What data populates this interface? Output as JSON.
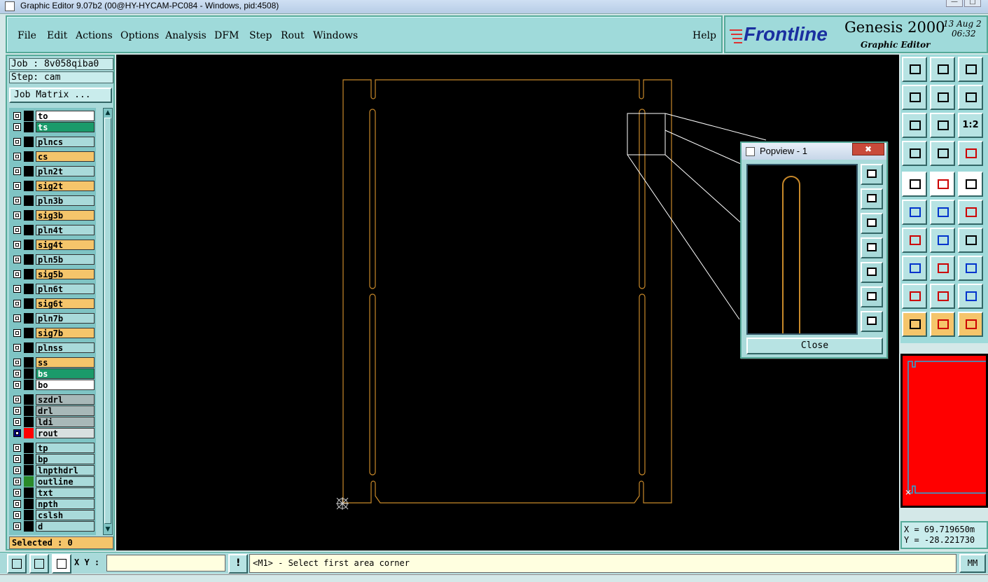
{
  "window": {
    "title": "Graphic Editor 9.07b2 (00@HY-HYCAM-PC084 - Windows, pid:4508)"
  },
  "menu": {
    "items": [
      "File",
      "Edit",
      "Actions",
      "Options",
      "Analysis",
      "DFM",
      "Step",
      "Rout",
      "Windows"
    ],
    "help": "Help"
  },
  "brand": {
    "logo": "Frontline",
    "product": "Genesis 2000",
    "subtitle": "Graphic Editor",
    "date": "13 Aug 2",
    "time": "06:32"
  },
  "job": {
    "job_line": "Job : 8v058qiba0",
    "step_line": "Step: cam",
    "matrix_button": "Job Matrix ..."
  },
  "layers": [
    {
      "name": "to",
      "color": "#ffffff"
    },
    {
      "name": "ts",
      "color": "#1a9a6a"
    },
    {
      "name": "plncs",
      "color": "#a9dada"
    },
    {
      "name": "cs",
      "color": "#f5c56b"
    },
    {
      "name": "pln2t",
      "color": "#a9dada"
    },
    {
      "name": "sig2t",
      "color": "#f5c56b"
    },
    {
      "name": "pln3b",
      "color": "#a9dada"
    },
    {
      "name": "sig3b",
      "color": "#f5c56b"
    },
    {
      "name": "pln4t",
      "color": "#a9dada"
    },
    {
      "name": "sig4t",
      "color": "#f5c56b"
    },
    {
      "name": "pln5b",
      "color": "#a9dada"
    },
    {
      "name": "sig5b",
      "color": "#f5c56b"
    },
    {
      "name": "pln6t",
      "color": "#a9dada"
    },
    {
      "name": "sig6t",
      "color": "#f5c56b"
    },
    {
      "name": "pln7b",
      "color": "#a9dada"
    },
    {
      "name": "sig7b",
      "color": "#f5c56b"
    },
    {
      "name": "plnss",
      "color": "#a9dada"
    },
    {
      "name": "ss",
      "color": "#f5c56b"
    },
    {
      "name": "bs",
      "color": "#1a9a6a"
    },
    {
      "name": "bo",
      "color": "#ffffff"
    },
    {
      "name": "szdrl",
      "color": "#a8b8b8"
    },
    {
      "name": "drl",
      "color": "#a8b8b8"
    },
    {
      "name": "ldi",
      "color": "#a8b8b8"
    },
    {
      "name": "rout",
      "color": "#d8e0e0",
      "active": true
    },
    {
      "name": "tp",
      "color": "#a9dada"
    },
    {
      "name": "bp",
      "color": "#a9dada"
    },
    {
      "name": "lnpthdrl",
      "color": "#a9dada"
    },
    {
      "name": "outline",
      "color": "#a9dada",
      "swatch": "#2a8a2a"
    },
    {
      "name": "txt",
      "color": "#a9dada"
    },
    {
      "name": "npth",
      "color": "#a9dada"
    },
    {
      "name": "cslsh",
      "color": "#a9dada"
    },
    {
      "name": "d",
      "color": "#a9dada"
    }
  ],
  "selected": "Selected : 0",
  "popview": {
    "title": "Popview - 1",
    "close_x": "✖",
    "close_button": "Close"
  },
  "toolbar": {
    "zoom_label": "1:2"
  },
  "coords": {
    "x": "X = 69.719650m",
    "y": "Y = -28.221730"
  },
  "status": {
    "xy_label": "X Y :",
    "xy_value": "",
    "message": "<M1> - Select first area corner",
    "units": "MM",
    "warn": "!"
  },
  "colors": {
    "profile": "#c8892a",
    "canvas": "#000000",
    "accent": "#9fdada"
  }
}
